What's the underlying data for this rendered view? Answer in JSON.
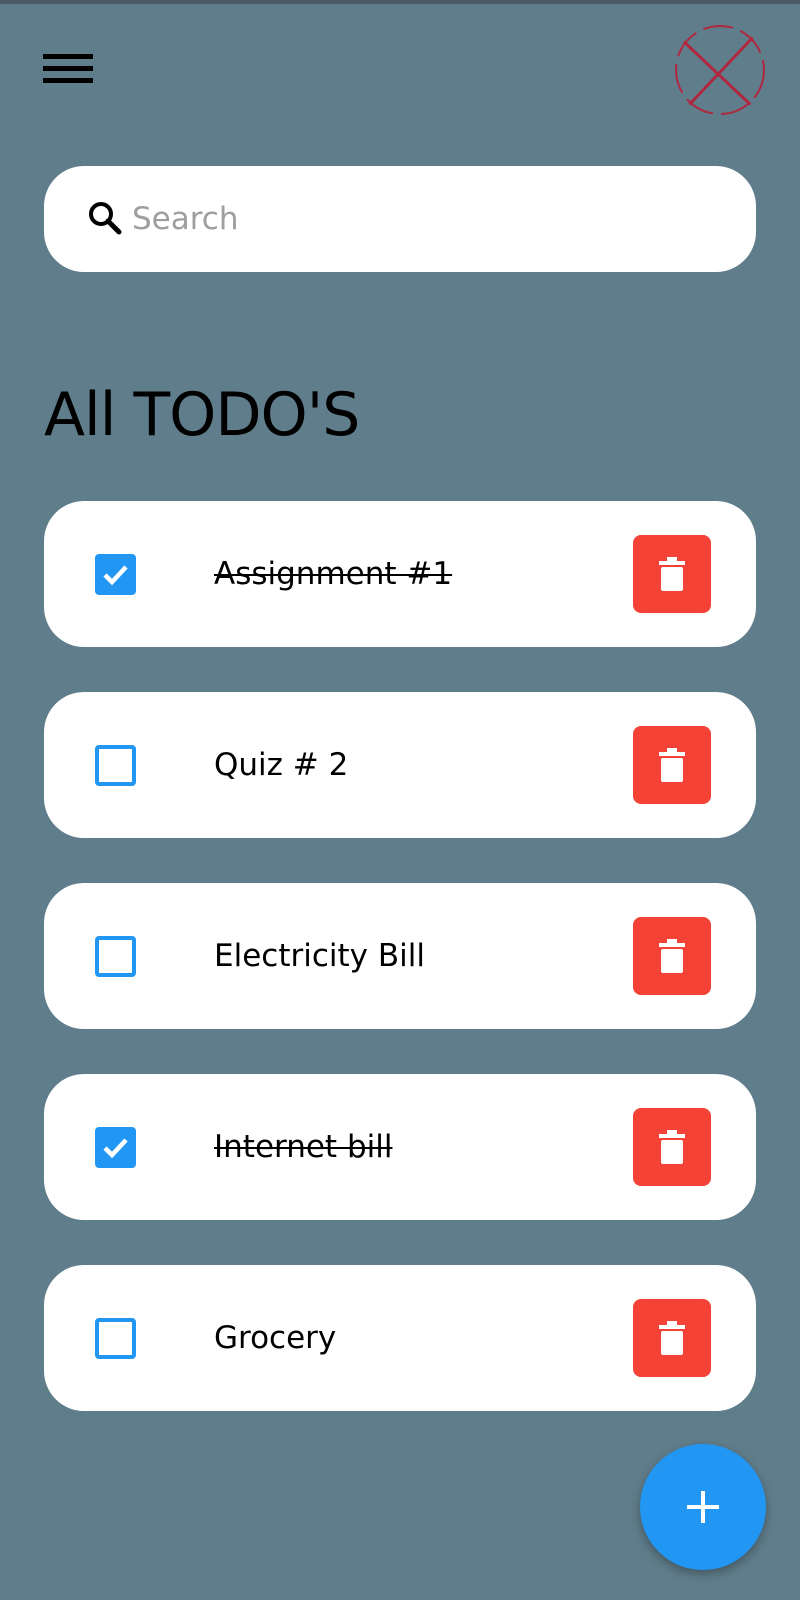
{
  "header": {
    "menu_icon": "menu-icon",
    "avatar_icon": "broken-image-icon"
  },
  "search": {
    "placeholder": "Search",
    "value": "",
    "icon": "search-icon"
  },
  "page": {
    "title": "All TODO'S"
  },
  "todos": [
    {
      "label": "Assignment #1",
      "done": true
    },
    {
      "label": "Quiz # 2",
      "done": false
    },
    {
      "label": "Electricity Bill",
      "done": false
    },
    {
      "label": "Internet bill",
      "done": true
    },
    {
      "label": "Grocery",
      "done": false
    }
  ],
  "fab": {
    "icon": "plus-icon"
  },
  "colors": {
    "background": "#607d8b",
    "card": "#ffffff",
    "accent": "#2196f3",
    "delete": "#f44336"
  }
}
